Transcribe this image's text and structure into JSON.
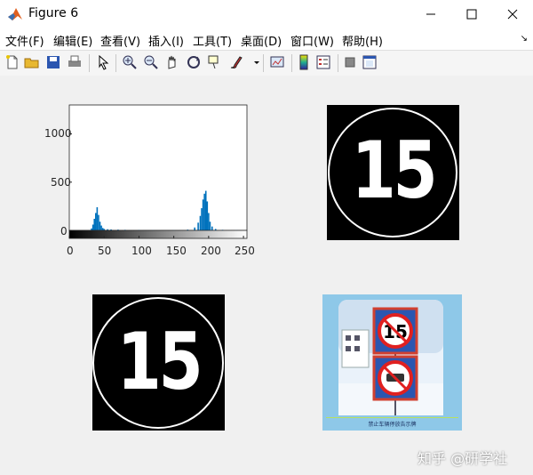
{
  "window": {
    "title": "Figure 6"
  },
  "menu": [
    "文件(F)",
    "编辑(E)",
    "查看(V)",
    "插入(I)",
    "工具(T)",
    "桌面(D)",
    "窗口(W)",
    "帮助(H)"
  ],
  "toolbar": {
    "icons": [
      "new-figure-icon",
      "open-file-icon",
      "save-icon",
      "print-icon",
      "pointer-icon",
      "zoom-in-icon",
      "zoom-out-icon",
      "pan-hand-icon",
      "rotate-3d-icon",
      "data-cursor-icon",
      "brush-icon",
      "dropdown-arrow-icon",
      "link-plot-icon",
      "colorbar-icon",
      "legend-icon",
      "hide-plot-tools-icon",
      "show-plot-tools-icon"
    ]
  },
  "histogram": {
    "y_ticks": [
      "1000",
      "500",
      "0"
    ],
    "x_ticks": [
      "0",
      "50",
      "100",
      "150",
      "200",
      "250"
    ]
  },
  "images": {
    "sign_number": "15",
    "caption": "禁止车辆停放告示牌"
  },
  "watermark": "知乎 @研学社",
  "chart_data": {
    "type": "bar",
    "title": "",
    "xlabel": "",
    "ylabel": "",
    "xlim": [
      0,
      255
    ],
    "ylim": [
      0,
      1300
    ],
    "x": [
      30,
      32,
      34,
      36,
      38,
      40,
      42,
      44,
      46,
      48,
      50,
      55,
      60,
      70,
      80,
      100,
      120,
      150,
      170,
      180,
      185,
      188,
      190,
      192,
      194,
      196,
      198,
      200,
      202,
      205,
      210,
      220,
      240
    ],
    "values": [
      5,
      20,
      60,
      120,
      180,
      240,
      160,
      90,
      50,
      25,
      15,
      12,
      10,
      8,
      6,
      5,
      4,
      4,
      8,
      30,
      80,
      150,
      230,
      320,
      380,
      410,
      300,
      180,
      90,
      40,
      15,
      6,
      3
    ]
  },
  "colors": {
    "hist_bar": "#0072bd",
    "accent": "#ffffff"
  }
}
